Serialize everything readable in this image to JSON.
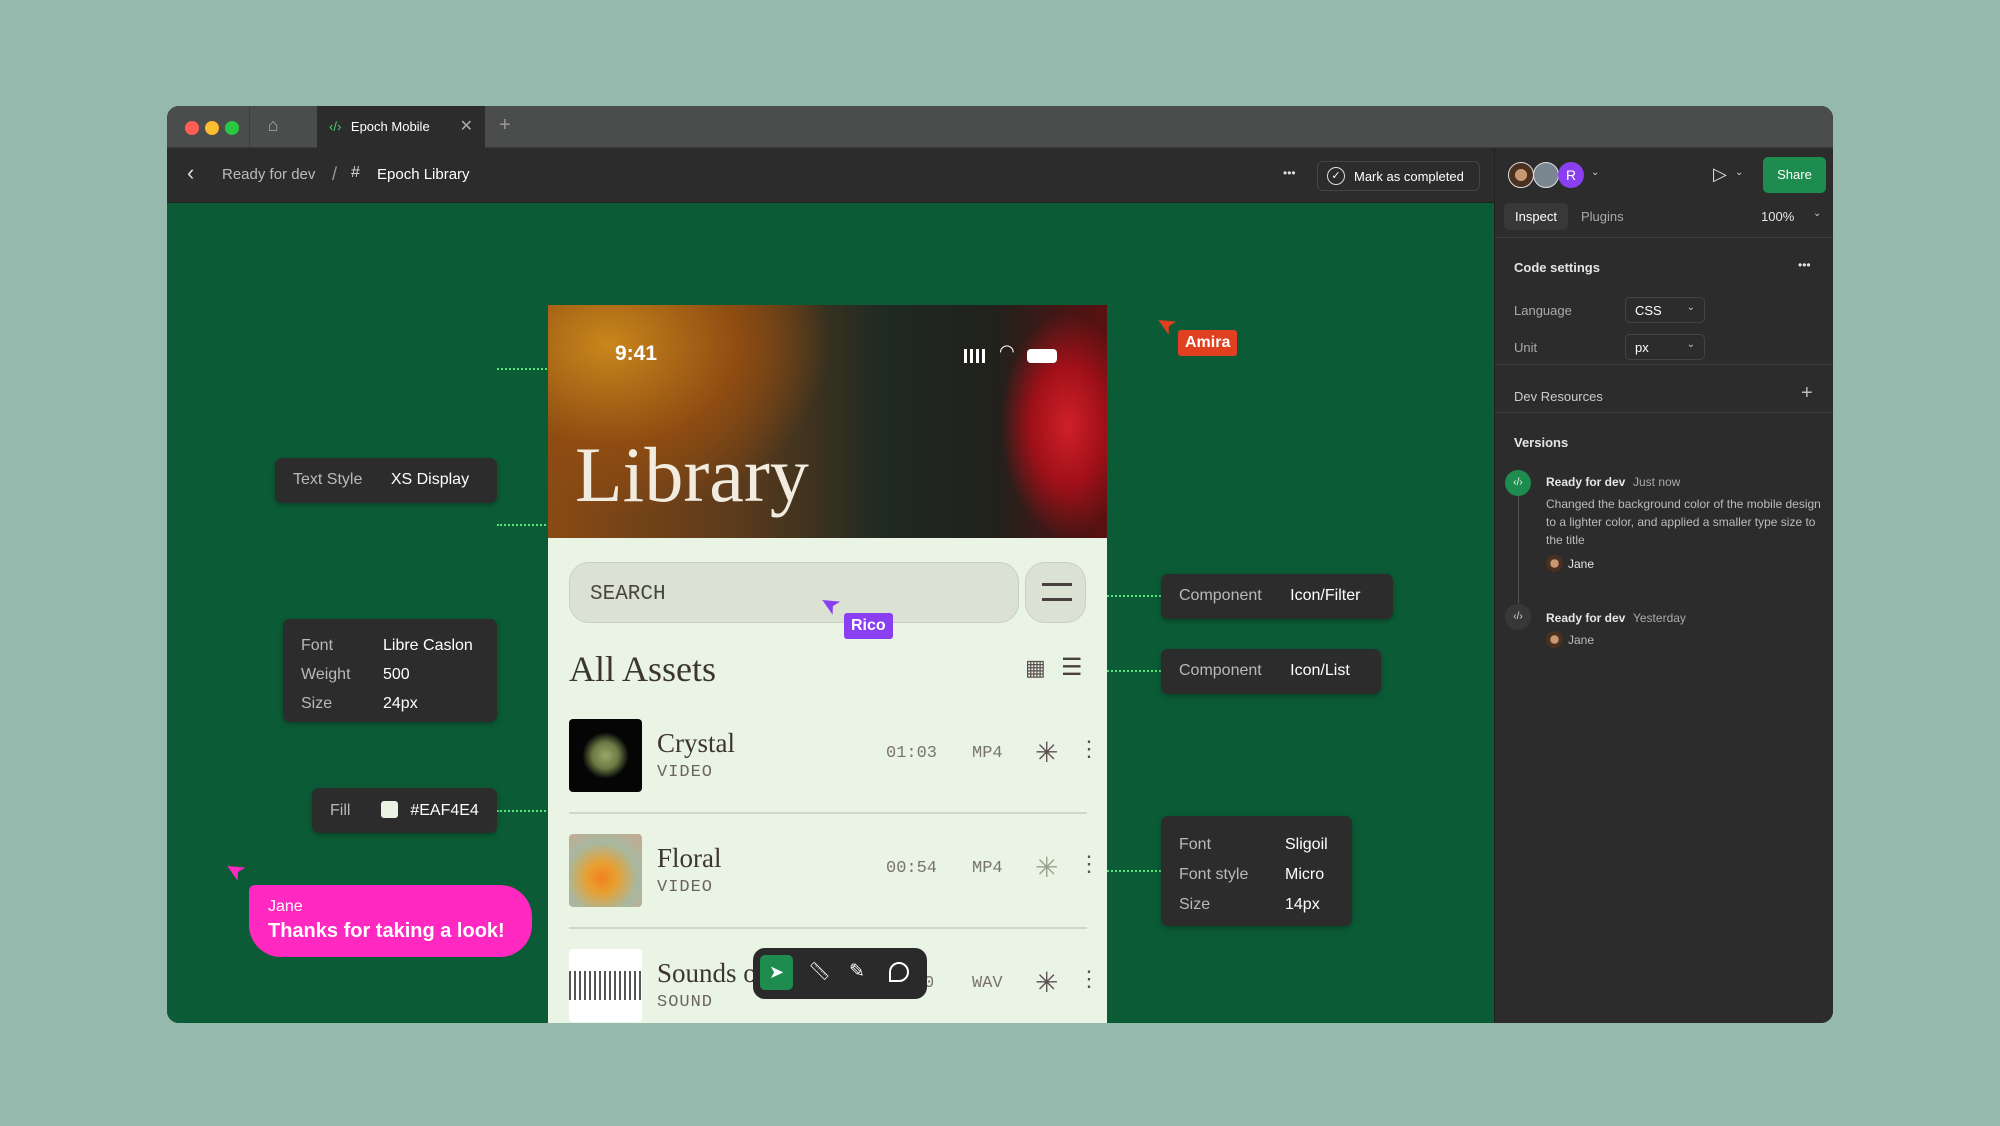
{
  "tab": {
    "title": "Epoch Mobile"
  },
  "toolbar": {
    "back": "‹",
    "breadcrumb_parent": "Ready for dev",
    "separator": "/",
    "breadcrumb_current": "Epoch Library",
    "more": "•••",
    "mark_completed": "Mark as completed"
  },
  "panel": {
    "avatar_r": "R",
    "share": "Share",
    "tabs": [
      "Inspect",
      "Plugins"
    ],
    "zoom": "100%",
    "code_settings": "Code settings",
    "language_label": "Language",
    "language_value": "CSS",
    "unit_label": "Unit",
    "unit_value": "px",
    "dev_resources": "Dev Resources",
    "versions_title": "Versions",
    "versions": [
      {
        "title": "Ready for dev",
        "time": "Just now",
        "desc": "Changed the background color of the mobile design to a lighter color, and applied a smaller type size to the title",
        "author": "Jane"
      },
      {
        "title": "Ready for dev",
        "time": "Yesterday",
        "author": "Jane"
      }
    ]
  },
  "phone": {
    "time": "9:41",
    "title": "Library",
    "search_placeholder": "SEARCH",
    "section": "All Assets",
    "rows": [
      {
        "title": "Crystal",
        "type": "VIDEO",
        "duration": "01:03",
        "format": "MP4"
      },
      {
        "title": "Floral",
        "type": "VIDEO",
        "duration": "00:54",
        "format": "MP4"
      },
      {
        "title": "Sounds o",
        "type": "SOUND",
        "duration": "0",
        "format": "WAV"
      }
    ]
  },
  "annotations": {
    "text_style": {
      "k": "Text Style",
      "v": "XS Display"
    },
    "font_left": [
      {
        "k": "Font",
        "v": "Libre Caslon"
      },
      {
        "k": "Weight",
        "v": "500"
      },
      {
        "k": "Size",
        "v": "24px"
      }
    ],
    "fill": {
      "k": "Fill",
      "v": "#EAF4E4"
    },
    "filter": {
      "k": "Component",
      "v": "Icon/Filter"
    },
    "list": {
      "k": "Component",
      "v": "Icon/List"
    },
    "font_right": [
      {
        "k": "Font",
        "v": "Sligoil"
      },
      {
        "k": "Font style",
        "v": "Micro"
      },
      {
        "k": "Size",
        "v": "14px"
      }
    ]
  },
  "cursors": {
    "amira": "Amira",
    "rico": "Rico",
    "jane_name": "Jane",
    "jane_msg": "Thanks for taking a look!"
  },
  "colors": {
    "canvas": "#0b5c36",
    "accent": "#1e8c4e",
    "amira": "#e0401f",
    "rico": "#8a3ff0",
    "jane": "#ff28c0",
    "connector": "#5be37a"
  }
}
